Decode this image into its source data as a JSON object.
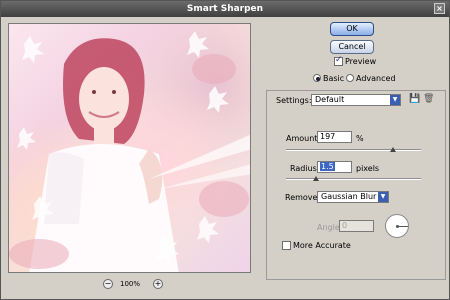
{
  "window": {
    "title": "Smart Sharpen"
  },
  "buttons": {
    "ok": "OK",
    "cancel": "Cancel"
  },
  "preview": {
    "label": "Preview",
    "checked": true
  },
  "mode": {
    "basic": "Basic",
    "advanced": "Advanced",
    "selected": "Basic"
  },
  "settings": {
    "label": "Settings:",
    "value": "Default"
  },
  "amount": {
    "label": "Amount:",
    "value": "197",
    "unit": "%"
  },
  "radius": {
    "label": "Radius:",
    "value": "1.5",
    "unit": "pixels"
  },
  "remove": {
    "label": "Remove:",
    "value": "Gaussian Blur"
  },
  "angle": {
    "label": "Angle:",
    "value": "0"
  },
  "more_accurate": {
    "label": "More Accurate",
    "checked": false
  },
  "zoom": {
    "level": "100%"
  },
  "icons": {
    "save_settings": "disk-icon",
    "delete_settings": "trash-icon",
    "zoom_out": "minus-icon",
    "zoom_in": "plus-icon",
    "close": "close-icon"
  },
  "colors": {
    "accent": "#3a5fb0",
    "dialog_bg": "#d4d0c8"
  }
}
